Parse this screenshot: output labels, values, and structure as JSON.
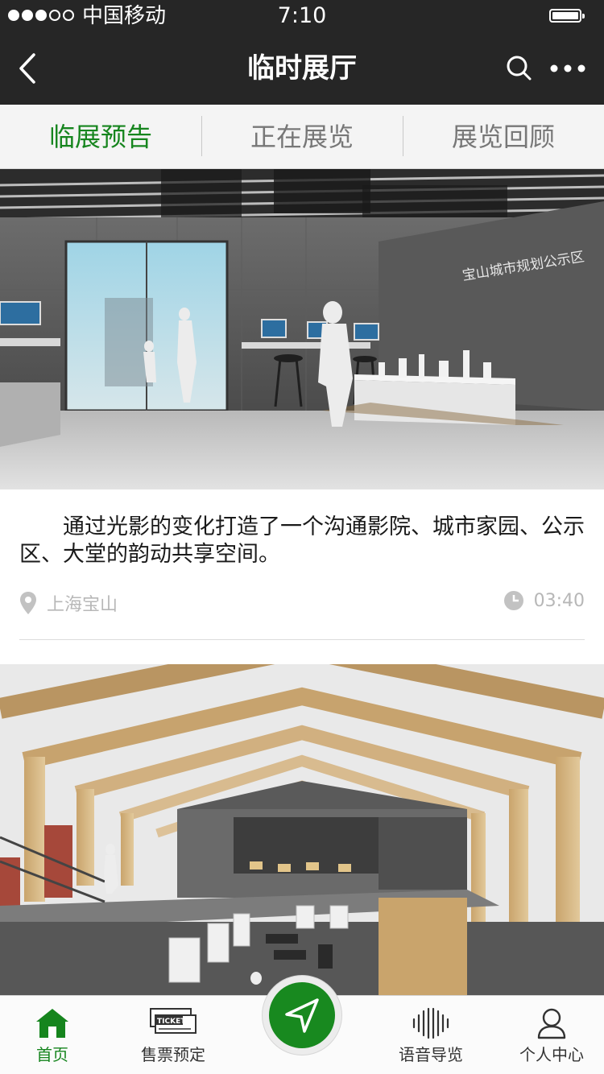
{
  "status_bar": {
    "carrier": "中国移动",
    "time": "7:10"
  },
  "nav": {
    "title": "临时展厅",
    "back_icon": "chevron-left-icon",
    "search_icon": "search-icon",
    "more_icon": "more-dots-icon"
  },
  "tabs": [
    {
      "label": "临展预告",
      "active": true
    },
    {
      "label": "正在展览",
      "active": false
    },
    {
      "label": "展览回顾",
      "active": false
    }
  ],
  "cards": [
    {
      "description": "通过光影的变化打造了一个沟通影院、城市家园、公示区、大堂的韵动共享空间。",
      "location": "上海宝山",
      "duration": "03:40",
      "image_signage": "宝山城市规划公示区"
    }
  ],
  "tabbar": {
    "items": [
      {
        "label": "首页",
        "icon": "home-icon",
        "active": true
      },
      {
        "label": "售票预定",
        "icon": "ticket-icon",
        "active": false
      },
      {
        "label": "语音导览",
        "icon": "audio-wave-icon",
        "active": false
      },
      {
        "label": "个人中心",
        "icon": "user-icon",
        "active": false
      }
    ],
    "center_icon": "navigation-arrow-icon",
    "ticket_text": "TICKET"
  },
  "colors": {
    "accent": "#16851e",
    "header": "#262626",
    "tabs_bg": "#f4f4f4",
    "muted": "#b7b7b7"
  }
}
